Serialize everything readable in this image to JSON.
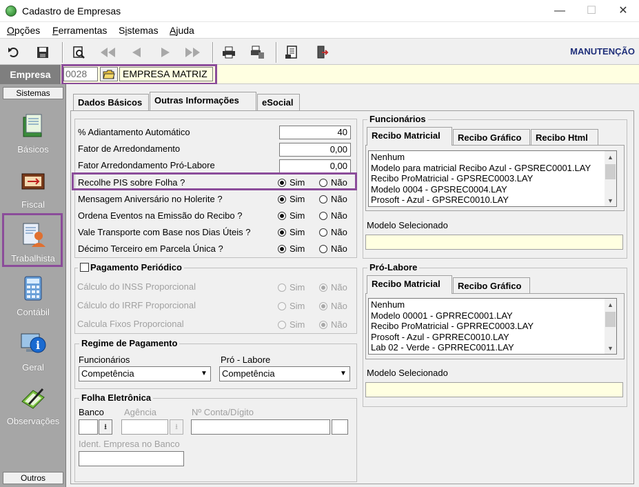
{
  "window": {
    "title": "Cadastro de Empresas",
    "controls": {
      "minimize": "—",
      "maximize": "☐",
      "close": "✕"
    }
  },
  "menu": {
    "items": [
      {
        "label": "Opções",
        "mnemonic": "O"
      },
      {
        "label": "Ferramentas",
        "mnemonic": "F"
      },
      {
        "label": "Sistemas",
        "mnemonic": "i"
      },
      {
        "label": "Ajuda",
        "mnemonic": "A"
      }
    ]
  },
  "toolbar": {
    "mode": "MANUTENÇÃO",
    "icons": [
      "undo-icon",
      "save-icon",
      "preview-icon",
      "first-icon",
      "previous-icon",
      "next-icon",
      "last-icon",
      "print-icon",
      "print-setup-icon",
      "report-icon",
      "exit-icon"
    ]
  },
  "empresa": {
    "label": "Empresa",
    "code": "0028",
    "name": "EMPRESA MATRIZ"
  },
  "sidebar": {
    "header_top": "Sistemas",
    "header_bottom": "Outros",
    "items": [
      {
        "label": "Básicos",
        "icon": "basicos-icon"
      },
      {
        "label": "Fiscal",
        "icon": "fiscal-icon"
      },
      {
        "label": "Trabalhista",
        "icon": "trabalhista-icon"
      },
      {
        "label": "Contábil",
        "icon": "calculator-icon"
      },
      {
        "label": "Geral",
        "icon": "info-globe-icon"
      },
      {
        "label": "Observações",
        "icon": "notes-icon"
      }
    ]
  },
  "tabs": [
    {
      "label": "Dados Básicos"
    },
    {
      "label": "Outras Informações"
    },
    {
      "label": "eSocial"
    }
  ],
  "fields": {
    "adiantamento": {
      "label": "% Adiantamento Automático",
      "value": "40"
    },
    "arredondamento": {
      "label": "Fator de Arredondamento",
      "value": "0,00"
    },
    "arredondamento_pl": {
      "label": "Fator Arredondamento Pró-Labore",
      "value": "0,00"
    }
  },
  "options": [
    {
      "label": "Recolhe PIS sobre Folha ?",
      "yes": "Sim",
      "no": "Não",
      "selected": "Sim"
    },
    {
      "label": "Mensagem Aniversário no Holerite ?",
      "yes": "Sim",
      "no": "Não",
      "selected": "Sim"
    },
    {
      "label": "Ordena Eventos na Emissão do Recibo ?",
      "yes": "Sim",
      "no": "Não",
      "selected": "Sim"
    },
    {
      "label": "Vale Transporte com Base nos Dias Úteis ?",
      "yes": "Sim",
      "no": "Não",
      "selected": "Sim"
    },
    {
      "label": "Décimo Terceiro em Parcela Única ?",
      "yes": "Sim",
      "no": "Não",
      "selected": "Sim"
    }
  ],
  "pagamento_periodico": {
    "title": "Pagamento Periódico",
    "checked": false,
    "rows": [
      {
        "label": "Cálculo do INSS Proporcional",
        "yes": "Sim",
        "no": "Não",
        "selected": "Não"
      },
      {
        "label": "Cálculo do IRRF Proporcional",
        "yes": "Sim",
        "no": "Não",
        "selected": "Não"
      },
      {
        "label": "Calcula Fixos Proporcional",
        "yes": "Sim",
        "no": "Não",
        "selected": "Não"
      }
    ]
  },
  "regime": {
    "title": "Regime de Pagamento",
    "funcionarios_label": "Funcionários",
    "funcionarios_value": "Competência",
    "prolabore_label": "Pró - Labore",
    "prolabore_value": "Competência"
  },
  "folha": {
    "title": "Folha Eletrônica",
    "banco_label": "Banco",
    "agencia_label": "Agência",
    "conta_label": "Nº Conta/Dígito",
    "ident_label": "Ident. Empresa no Banco"
  },
  "funcionarios": {
    "title": "Funcionários",
    "tabs": [
      "Recibo Matricial",
      "Recibo Gráfico",
      "Recibo Html"
    ],
    "list": [
      "Nenhum",
      "Modelo para matricial Recibo Azul - GPSREC0001.LAY",
      "Recibo ProMatricial - GPSREC0003.LAY",
      "Modelo 0004 - GPSREC0004.LAY",
      "Prosoft - Azul - GPSREC0010.LAY"
    ],
    "selected_label": "Modelo Selecionado"
  },
  "prolabore": {
    "title": "Pró-Labore",
    "tabs": [
      "Recibo Matricial",
      "Recibo Gráfico"
    ],
    "list": [
      "Nenhum",
      "Modelo 00001 - GPRREC0001.LAY",
      "Recibo ProMatricial - GPRREC0003.LAY",
      "Prosoft - Azul - GPRREC0010.LAY",
      "Lab 02 - Verde - GPRREC0011.LAY"
    ],
    "selected_label": "Modelo Selecionado"
  },
  "colors": {
    "highlight": "#8b4c9a",
    "sidebar": "#a6a6a6",
    "info_bg": "#ffffe1",
    "mode_text": "#1f2f7a"
  }
}
